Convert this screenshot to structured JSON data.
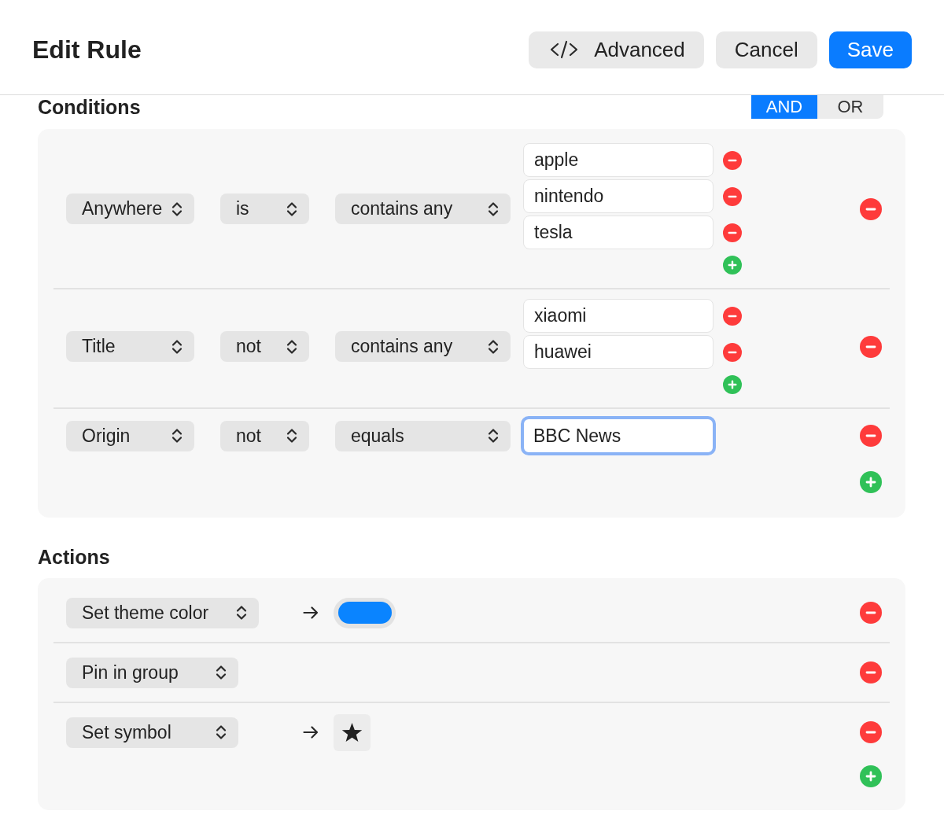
{
  "window": {
    "title": "Edit Rule"
  },
  "toolbar": {
    "buttons": [
      {
        "label": "Advanced",
        "kind": "code"
      },
      {
        "label": "Cancel",
        "kind": "plain"
      },
      {
        "label": "Save",
        "kind": "primary"
      }
    ]
  },
  "conditions": {
    "title": "Conditions",
    "match_mode": [
      {
        "label": "AND",
        "selected": true
      },
      {
        "label": "OR",
        "selected": false
      }
    ],
    "rows": [
      {
        "field": "Anywhere",
        "operator": "is",
        "comparison": "contains any",
        "kind": "list",
        "values": [
          {
            "text": "apple",
            "focused": false
          },
          {
            "text": "nintendo",
            "focused": false
          },
          {
            "text": "tesla",
            "focused": false
          }
        ]
      },
      {
        "field": "Title",
        "operator": "not",
        "comparison": "contains any",
        "kind": "list",
        "values": [
          {
            "text": "xiaomi",
            "focused": false
          },
          {
            "text": "huawei",
            "focused": false
          }
        ]
      },
      {
        "field": "Origin",
        "operator": "not",
        "comparison": "equals",
        "kind": "single",
        "values": [
          {
            "text": "BBC News",
            "focused": true
          }
        ]
      }
    ]
  },
  "actions": {
    "title": "Actions",
    "rows": [
      {
        "action": "Set theme color",
        "kind": "color",
        "color": "#0a84ff"
      },
      {
        "action": "Pin in group",
        "kind": "plain"
      },
      {
        "action": "Set symbol",
        "kind": "symbol"
      }
    ]
  }
}
